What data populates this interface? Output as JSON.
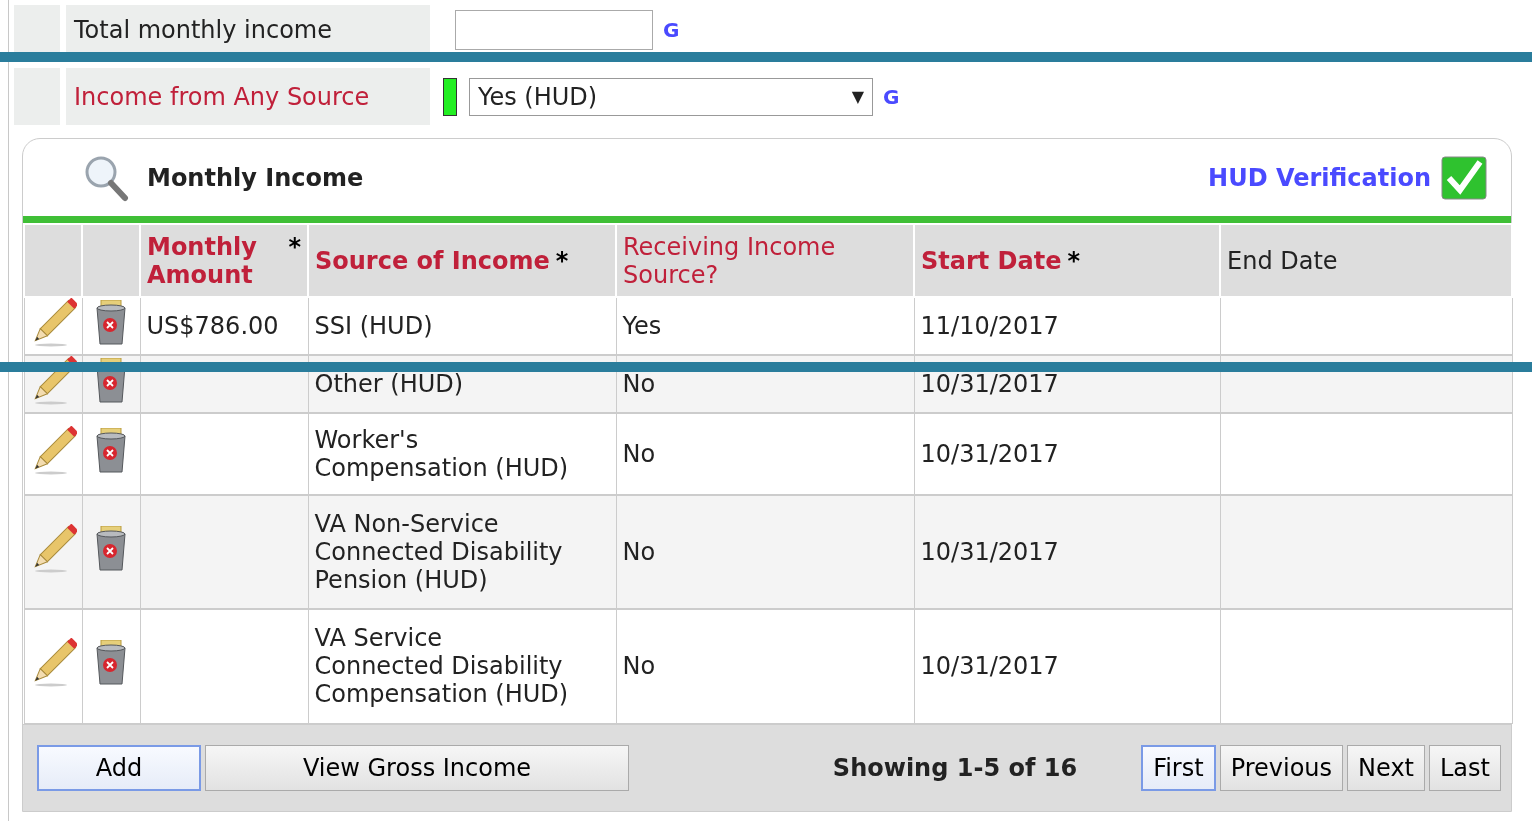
{
  "fields": [
    {
      "label": "Total monthly income",
      "required": false,
      "kind": "text",
      "link": "G"
    },
    {
      "label": "Income from Any Source",
      "required": true,
      "kind": "select",
      "value": "Yes (HUD)",
      "caret": "▼",
      "status_ok": true,
      "link": "G"
    }
  ],
  "panel": {
    "title": "Monthly Income",
    "verification": {
      "label": "HUD Verification",
      "checked": true
    },
    "columns": [
      {
        "label": "Monthly Amount",
        "kind": "required",
        "marker": "*"
      },
      {
        "label": "Source of Income",
        "kind": "required",
        "marker": "*"
      },
      {
        "label": "Receiving Income Source?",
        "kind": "conditional"
      },
      {
        "label": "Start Date",
        "kind": "required",
        "marker": "*"
      },
      {
        "label": "End Date",
        "kind": "optional"
      }
    ],
    "rows": [
      {
        "amount": "US$786.00",
        "source": "SSI (HUD)",
        "receiving": "Yes",
        "start": "11/10/2017"
      },
      {
        "source": "Other (HUD)",
        "receiving": "No",
        "start": "10/31/2017"
      },
      {
        "source": "Worker's\nCompensation (HUD)",
        "receiving": "No",
        "start": "10/31/2017"
      },
      {
        "source": "VA Non-Service\nConnected Disability\nPension (HUD)",
        "receiving": "No",
        "start": "10/31/2017"
      },
      {
        "source": "VA Service\nConnected Disability\nCompensation (HUD)",
        "receiving": "No",
        "start": "10/31/2017"
      }
    ],
    "actions": [
      {
        "label": "Add",
        "focused": true
      },
      {
        "label": "View Gross Income",
        "focused": false
      }
    ],
    "paging_text": "Showing 1-5 of 16",
    "pager": [
      {
        "label": "First",
        "selected": true
      },
      {
        "label": "Previous",
        "selected": false
      },
      {
        "label": "Next",
        "selected": false
      },
      {
        "label": "Last",
        "selected": false
      }
    ]
  }
}
